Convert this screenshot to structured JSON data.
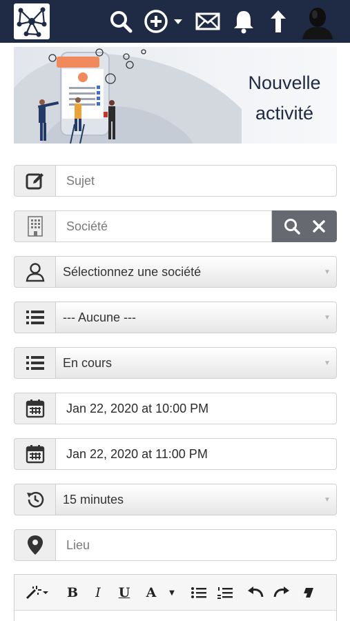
{
  "header": {
    "logo_icon": "network-graph-logo",
    "icons": [
      "search-icon",
      "add-circle-icon",
      "caret-down-icon",
      "mail-icon",
      "bell-icon",
      "upload-arrow-icon",
      "user-avatar-icon"
    ]
  },
  "banner": {
    "title_line1": "Nouvelle",
    "title_line2": "activité"
  },
  "form": {
    "subject": {
      "placeholder": "Sujet",
      "icon": "edit-icon"
    },
    "company": {
      "placeholder": "Société",
      "icon": "building-icon"
    },
    "contact": {
      "value": "Sélectionnez une société",
      "icon": "person-icon"
    },
    "category": {
      "value": "--- Aucune ---",
      "icon": "list-icon"
    },
    "status": {
      "value": "En cours",
      "icon": "list-icon"
    },
    "start": {
      "value": "Jan 22, 2020 at 10:00 PM",
      "icon": "calendar-icon"
    },
    "end": {
      "value": "Jan 22, 2020 at 11:00 PM",
      "icon": "calendar-icon"
    },
    "reminder": {
      "value": "15 minutes",
      "icon": "history-icon"
    },
    "location": {
      "placeholder": "Lieu",
      "icon": "map-pin-icon"
    }
  },
  "editor": {
    "bold": "B",
    "italic": "I",
    "underline": "U",
    "font_color": "A"
  },
  "colors": {
    "navbar": "#1f2b45",
    "addon_bg": "#eeeeee",
    "search_button": "#666a70"
  }
}
